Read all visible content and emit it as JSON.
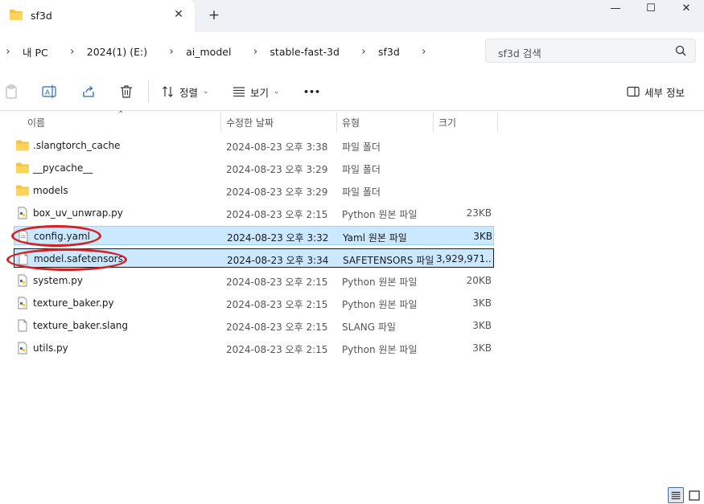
{
  "window": {
    "tab_title": "sf3d",
    "tab_close": "✕",
    "new_tab": "+",
    "minimize": "—",
    "maximize": "☐",
    "close": "✕"
  },
  "address": {
    "crumbs": [
      "내 PC",
      "2024(1) (E:)",
      "ai_model",
      "stable-fast-3d",
      "sf3d"
    ],
    "search_placeholder": "sf3d 검색"
  },
  "toolbar": {
    "sort_label": "정렬",
    "view_label": "보기",
    "more_label": "•••",
    "details_label": "세부 정보"
  },
  "columns": {
    "name": "이름",
    "date": "수정한 날짜",
    "type": "유형",
    "size": "크기"
  },
  "files": [
    {
      "name": ".slangtorch_cache",
      "date": "2024-08-23 오후 3:38",
      "type": "파일 폴더",
      "size": "",
      "icon": "folder-icon"
    },
    {
      "name": "__pycache__",
      "date": "2024-08-23 오후 3:29",
      "type": "파일 폴더",
      "size": "",
      "icon": "folder-icon"
    },
    {
      "name": "models",
      "date": "2024-08-23 오후 3:29",
      "type": "파일 폴더",
      "size": "",
      "icon": "folder-icon"
    },
    {
      "name": "box_uv_unwrap.py",
      "date": "2024-08-23 오후 2:15",
      "type": "Python 원본 파일",
      "size": "23KB",
      "icon": "python-file-icon"
    },
    {
      "name": "config.yaml",
      "date": "2024-08-23 오후 3:32",
      "type": "Yaml 원본 파일",
      "size": "3KB",
      "icon": "yaml-file-icon",
      "selected": true
    },
    {
      "name": "model.safetensors",
      "date": "2024-08-23 오후 3:34",
      "type": "SAFETENSORS 파일",
      "size": "3,929,971...",
      "icon": "file-icon",
      "selected": true,
      "focused": true
    },
    {
      "name": "system.py",
      "date": "2024-08-23 오후 2:15",
      "type": "Python 원본 파일",
      "size": "20KB",
      "icon": "python-file-icon"
    },
    {
      "name": "texture_baker.py",
      "date": "2024-08-23 오후 2:15",
      "type": "Python 원본 파일",
      "size": "3KB",
      "icon": "python-file-icon"
    },
    {
      "name": "texture_baker.slang",
      "date": "2024-08-23 오후 2:15",
      "type": "SLANG 파일",
      "size": "3KB",
      "icon": "file-icon"
    },
    {
      "name": "utils.py",
      "date": "2024-08-23 오후 2:15",
      "type": "Python 원본 파일",
      "size": "3KB",
      "icon": "python-file-icon"
    }
  ],
  "colors": {
    "selection": "#cce8ff",
    "selection_border": "#99d1ff",
    "annotation": "#d42222",
    "folder": "#f3c346"
  }
}
